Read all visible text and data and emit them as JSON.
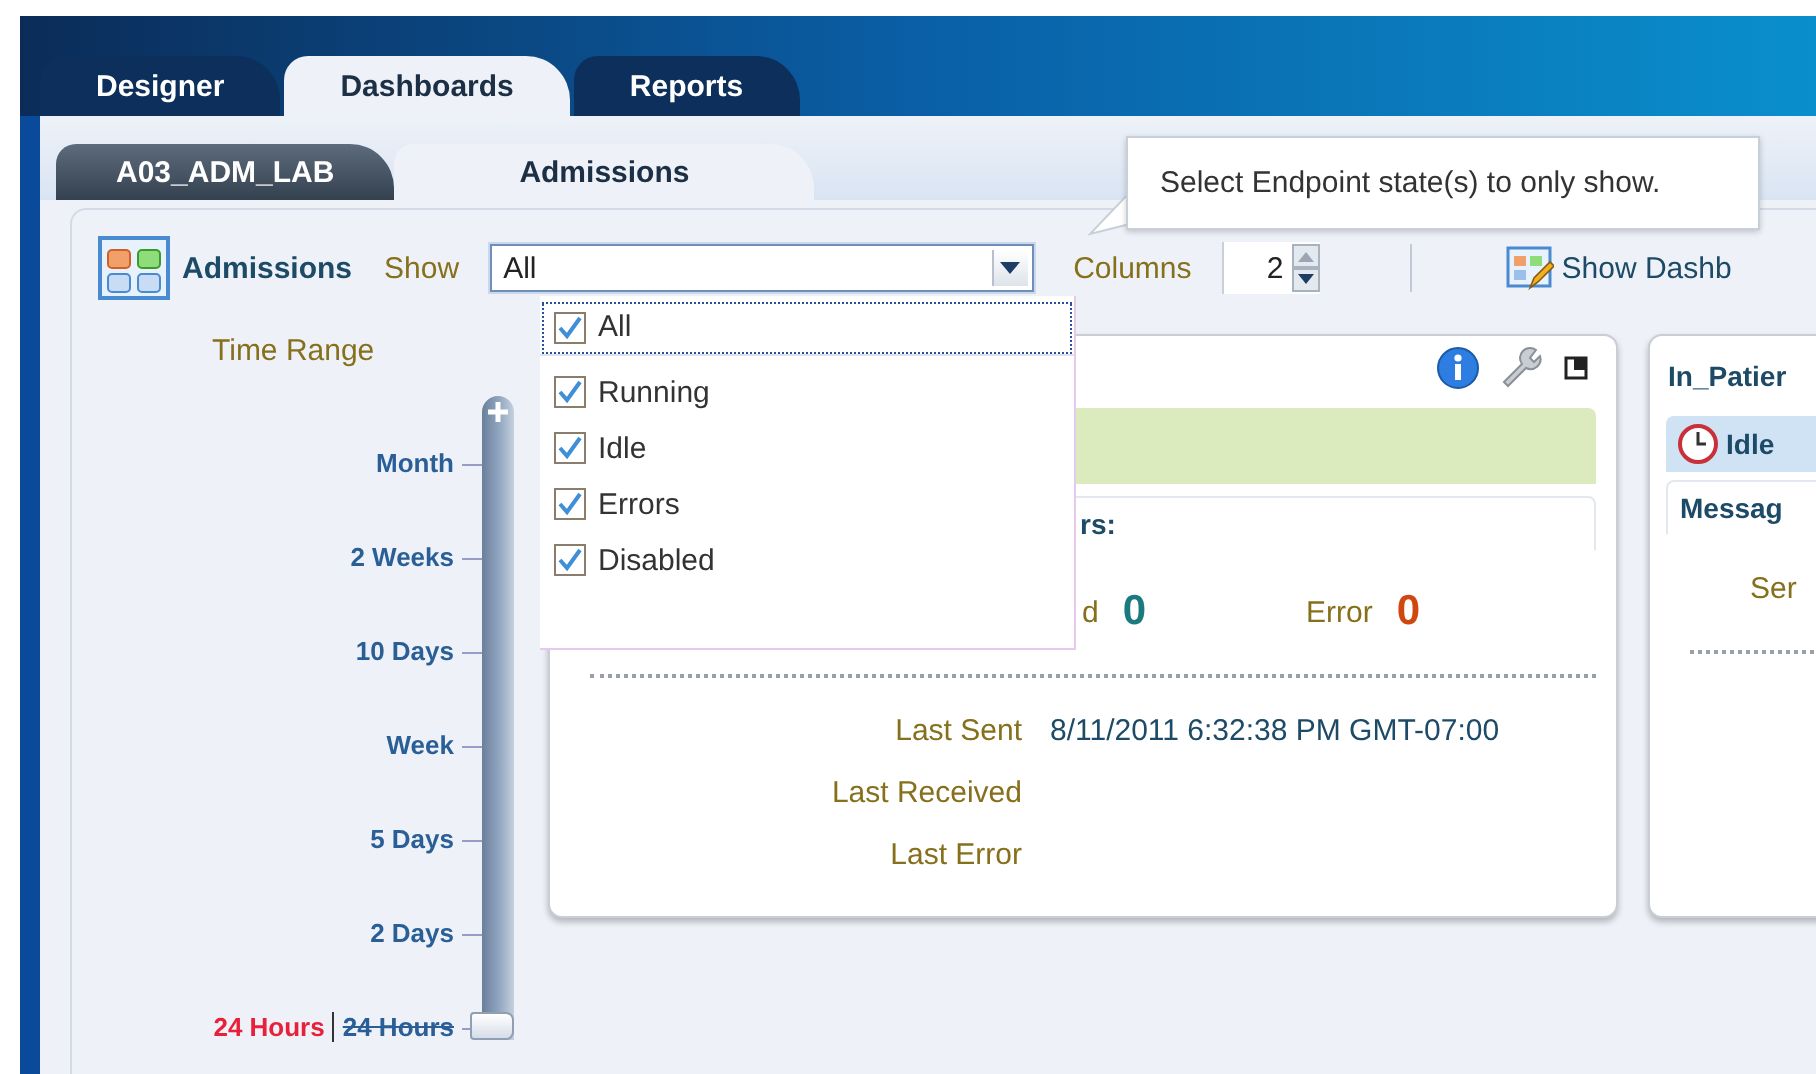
{
  "main_tabs": [
    {
      "label": "Designer",
      "selected": false
    },
    {
      "label": "Dashboards",
      "selected": true
    },
    {
      "label": "Reports",
      "selected": false
    }
  ],
  "sub_tabs": [
    {
      "label": "A03_ADM_LAB",
      "selected": false
    },
    {
      "label": "Admissions",
      "selected": true
    }
  ],
  "tooltip": {
    "text": "Select Endpoint state(s) to only show."
  },
  "toolbar": {
    "title": "Admissions",
    "show_label": "Show",
    "show_select": {
      "value": "All",
      "expanded": true,
      "options": [
        {
          "label": "All",
          "checked": true,
          "focused": true
        },
        {
          "label": "Running",
          "checked": true,
          "focused": false
        },
        {
          "label": "Idle",
          "checked": true,
          "focused": false
        },
        {
          "label": "Errors",
          "checked": true,
          "focused": false
        },
        {
          "label": "Disabled",
          "checked": true,
          "focused": false
        }
      ]
    },
    "columns_label": "Columns",
    "columns_value": "2",
    "show_dashboard_button": "Show Dashb"
  },
  "time_range": {
    "label": "Time Range",
    "current": "24 Hours",
    "level": 0,
    "ticks": [
      "Month",
      "2 Weeks",
      "10 Days",
      "Week",
      "5 Days",
      "2 Days",
      "24 Hours"
    ]
  },
  "cards": [
    {
      "kind": "tools_header",
      "status": {
        "color": "#dcebbd"
      },
      "section_heading": "rs:",
      "counts": [
        {
          "label": "d",
          "value": "0",
          "color": "#1a7a80"
        },
        {
          "label": "Error",
          "value": "0",
          "color": "#d0470f"
        }
      ],
      "details": [
        {
          "label": "Last Sent",
          "value": "8/11/2011 6:32:38 PM GMT-07:00"
        },
        {
          "label": "Last Received"
        },
        {
          "label": "Last Error"
        }
      ]
    },
    {
      "kind": "title_header",
      "title": "In_Patier",
      "status": {
        "label": "Idle",
        "color": "#cfe3f5"
      },
      "section_heading": "Messag",
      "counts": [
        {
          "label": "Ser"
        }
      ]
    }
  ]
}
